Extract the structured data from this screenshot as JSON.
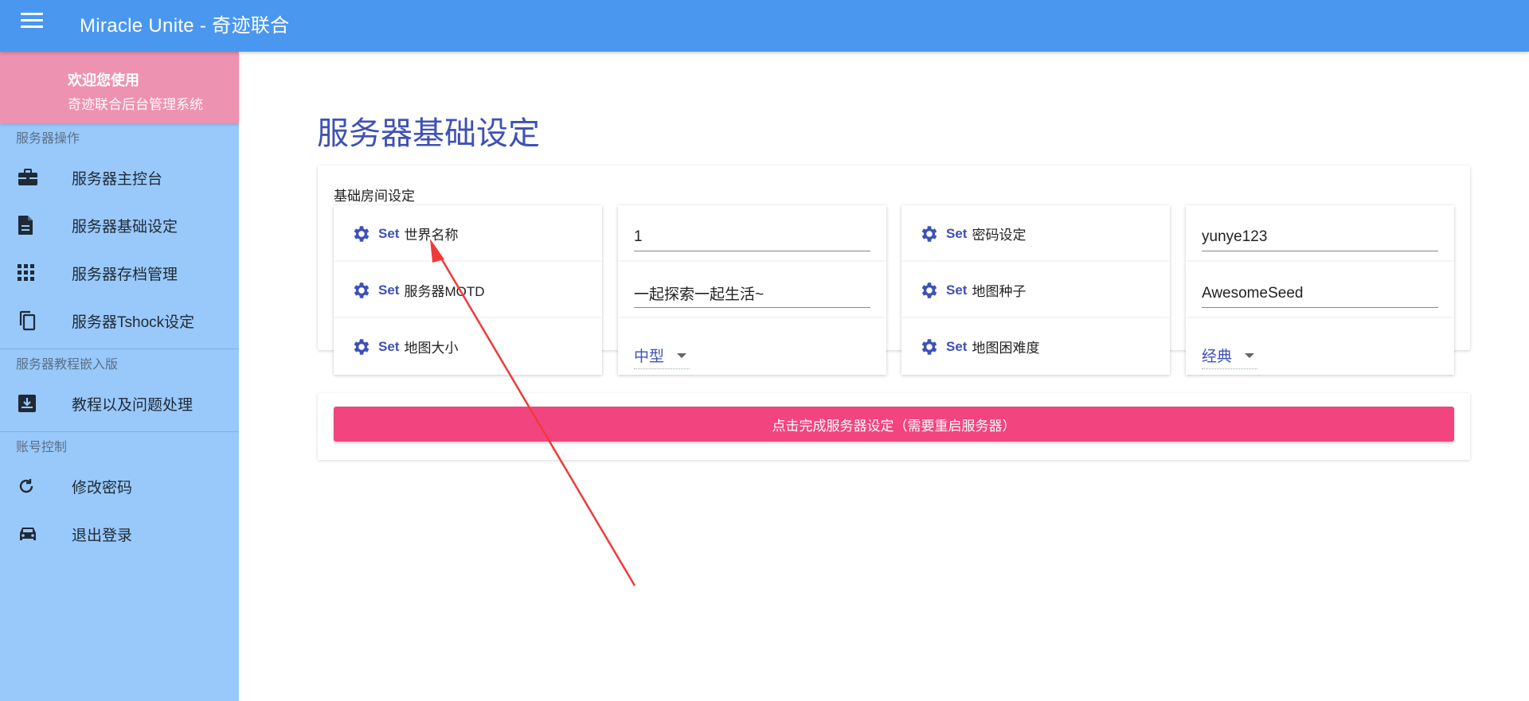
{
  "app": {
    "title": "Miracle Unite - 奇迹联合"
  },
  "sidebar": {
    "welcome": {
      "line1": "欢迎您使用",
      "line2": "奇迹联合后台管理系统"
    },
    "sections": [
      {
        "title": "服务器操作",
        "items": [
          {
            "label": "服务器主控台",
            "icon": "briefcase-icon"
          },
          {
            "label": "服务器基础设定",
            "icon": "document-icon"
          },
          {
            "label": "服务器存档管理",
            "icon": "grid-icon"
          },
          {
            "label": "服务器Tshock设定",
            "icon": "copy-icon"
          }
        ]
      },
      {
        "title": "服务器教程嵌入版",
        "items": [
          {
            "label": "教程以及问题处理",
            "icon": "inbox-download-icon"
          }
        ]
      },
      {
        "title": "账号控制",
        "items": [
          {
            "label": "修改密码",
            "icon": "refresh-icon"
          },
          {
            "label": "退出登录",
            "icon": "car-icon"
          }
        ]
      }
    ]
  },
  "main": {
    "page_title": "服务器基础设定",
    "panel_label": "基础房间设定",
    "set_label": "Set",
    "settings": [
      {
        "name": "世界名称",
        "value": "1"
      },
      {
        "name": "密码设定",
        "value": "yunye123"
      },
      {
        "name": "服务器MOTD",
        "value": "一起探索一起生活~"
      },
      {
        "name": "地图种子",
        "value": "AwesomeSeed"
      },
      {
        "name": "地图大小",
        "selected": "中型"
      },
      {
        "name": "地图困难度",
        "selected": "经典"
      }
    ],
    "submit_label": "点击完成服务器设定（需要重启服务器）"
  },
  "colors": {
    "appbar": "#4a97f0",
    "drawer": "#99c9fa",
    "welcome": "#ee92b1",
    "accent": "#3f51b5",
    "submit": "#f2447f",
    "annotation_arrow": "#f03a3a"
  }
}
